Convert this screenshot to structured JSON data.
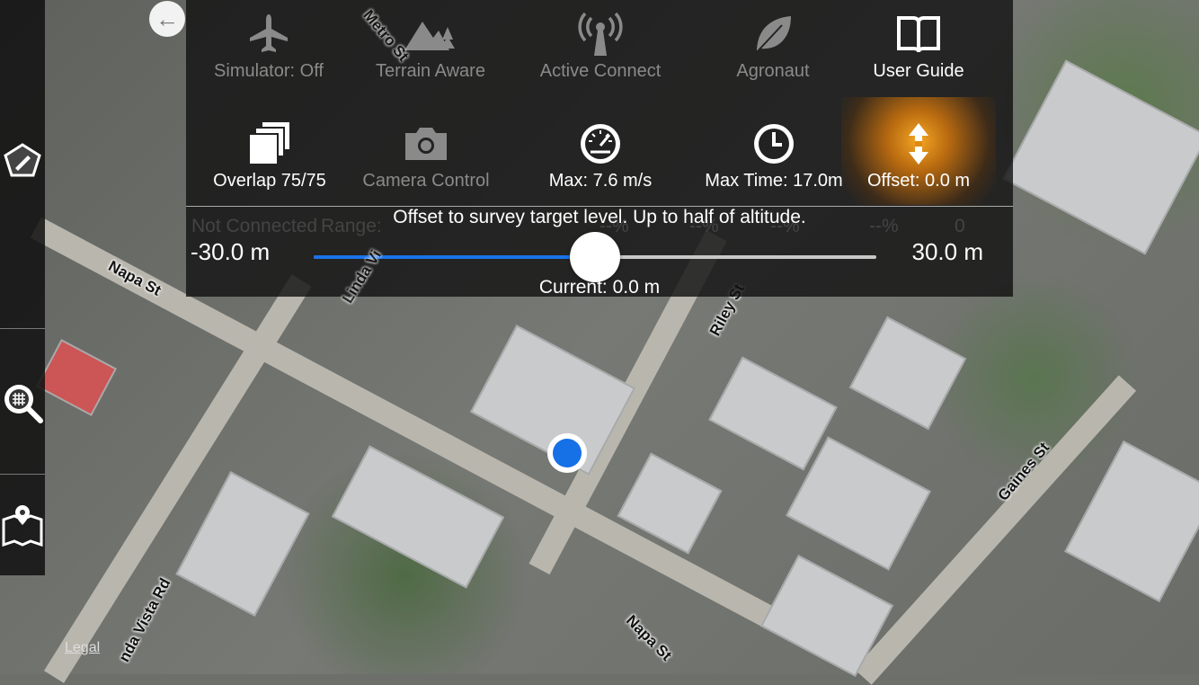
{
  "map": {
    "labels": {
      "metro": "Metro St",
      "napa1": "Napa St",
      "linda1": "Linda Vi",
      "linda2": "nda Vista Rd",
      "riley": "Riley St",
      "gaines": "Gaines St",
      "napa2": "Napa St"
    },
    "legal": "Legal"
  },
  "menu": {
    "row1": [
      {
        "label": "Simulator: Off",
        "icon": "airplane-icon",
        "active": false
      },
      {
        "label": "Terrain Aware",
        "icon": "mountains-icon",
        "active": false
      },
      {
        "label": "Active Connect",
        "icon": "antenna-icon",
        "active": false
      },
      {
        "label": "Agronaut",
        "icon": "leaf-icon",
        "active": false
      },
      {
        "label": "User Guide",
        "icon": "book-icon",
        "active": true
      }
    ],
    "row2": [
      {
        "label": "Overlap 75/75",
        "icon": "layers-icon",
        "active": true
      },
      {
        "label": "Camera Control",
        "icon": "camera-icon",
        "active": false
      },
      {
        "label": "Max: 7.6 m/s",
        "icon": "speedometer-icon",
        "active": true
      },
      {
        "label": "Max Time: 17.0m",
        "icon": "clock-icon",
        "active": true
      },
      {
        "label": "Offset: 0.0 m",
        "icon": "vertical-arrows-icon",
        "active": true,
        "selected": true
      }
    ]
  },
  "status": {
    "connection": "Not Connected",
    "range": "Range:",
    "phone": "--%",
    "controller": "--%",
    "hd": "--%",
    "drone": "--%",
    "satellites": "0"
  },
  "slider": {
    "hint": "Offset to survey target level. Up to half of altitude.",
    "min_label": "-30.0 m",
    "max_label": "30.0 m",
    "current_label": "Current: 0.0 m",
    "min": -30,
    "max": 30,
    "value": 0
  },
  "colors": {
    "accent": "#1a73e8",
    "selected": "#f5a623"
  }
}
